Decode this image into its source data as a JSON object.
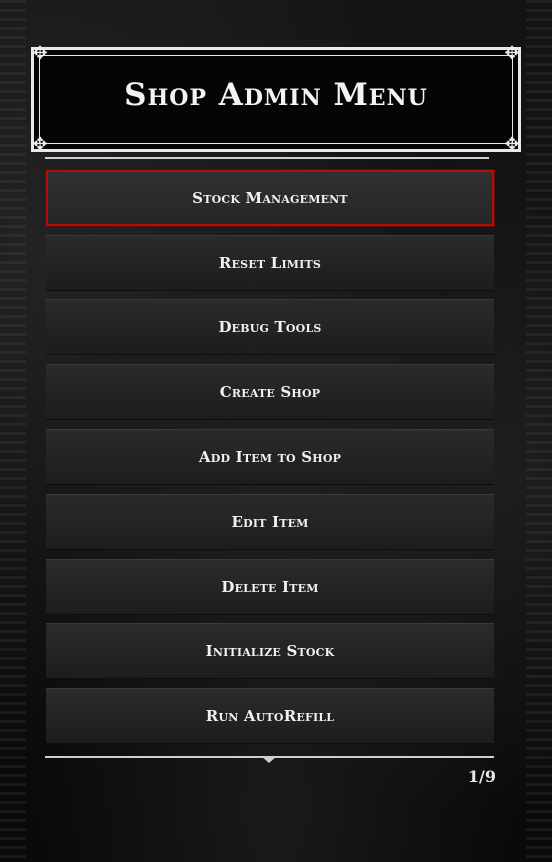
{
  "header": {
    "title": "Shop Admin Menu"
  },
  "menu": {
    "items": [
      {
        "label": "Stock Management"
      },
      {
        "label": "Reset Limits"
      },
      {
        "label": "Debug Tools"
      },
      {
        "label": "Create Shop"
      },
      {
        "label": "Add Item to Shop"
      },
      {
        "label": "Edit Item"
      },
      {
        "label": "Delete Item"
      },
      {
        "label": "Initialize Stock"
      },
      {
        "label": "Run AutoRefill"
      }
    ],
    "selected_index": 0
  },
  "footer": {
    "page_indicator": "1/9"
  },
  "colors": {
    "selection_border": "#b10e0e",
    "text": "#f1f1f1",
    "item_bg": "#262626"
  }
}
